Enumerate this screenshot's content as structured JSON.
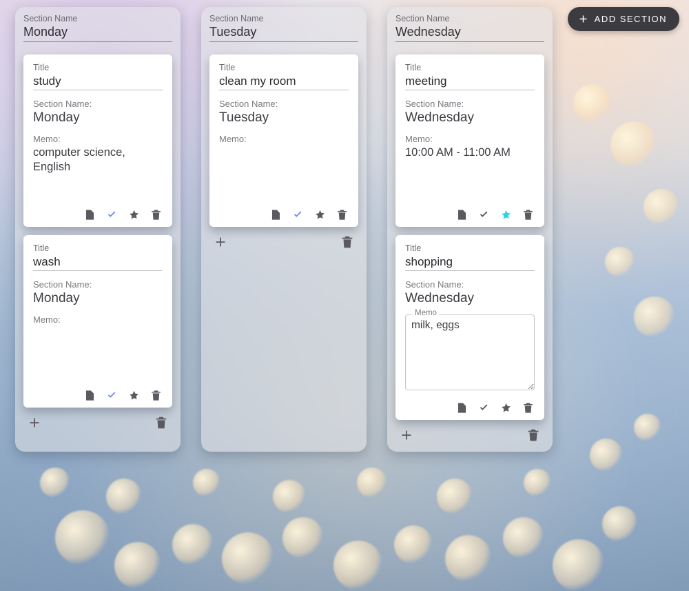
{
  "labels": {
    "section_name": "Section Name",
    "section_name_colon": "Section Name:",
    "title": "Title",
    "memo_colon": "Memo:",
    "memo_float": "Memo",
    "add_section": "ADD SECTION"
  },
  "sections": [
    {
      "name": "Monday",
      "cards": [
        {
          "title": "study",
          "section": "Monday",
          "memo": "computer science, English",
          "check_blue": true,
          "star_active": false,
          "editing": false
        },
        {
          "title": "wash",
          "section": "Monday",
          "memo": "",
          "check_blue": true,
          "star_active": false,
          "editing": false
        }
      ]
    },
    {
      "name": "Tuesday",
      "cards": [
        {
          "title": "clean my room",
          "section": "Tuesday",
          "memo": "",
          "check_blue": true,
          "star_active": false,
          "editing": false
        }
      ]
    },
    {
      "name": "Wednesday",
      "cards": [
        {
          "title": "meeting",
          "section": "Wednesday",
          "memo": "10:00 AM - 11:00 AM",
          "check_blue": false,
          "star_active": true,
          "editing": false
        },
        {
          "title": "shopping",
          "section": "Wednesday",
          "memo": "milk, eggs",
          "check_blue": false,
          "star_active": false,
          "editing": true
        }
      ]
    }
  ]
}
